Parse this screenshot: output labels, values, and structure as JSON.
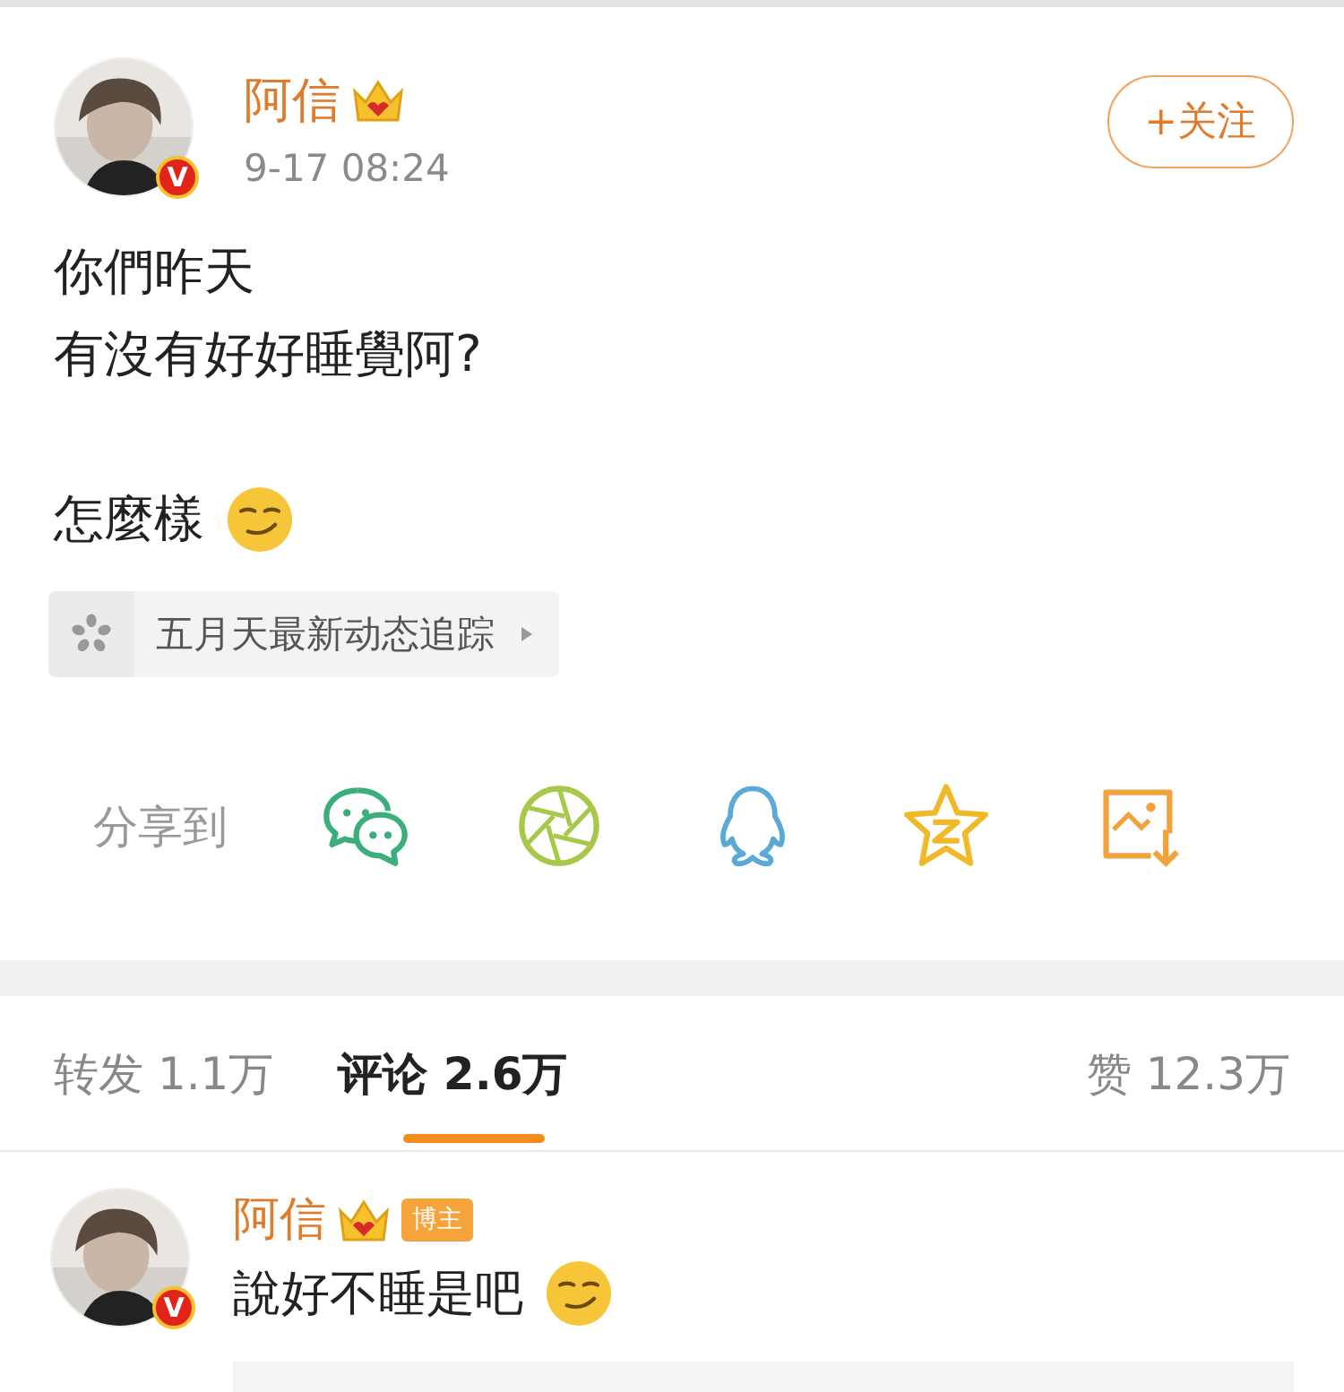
{
  "post": {
    "author": {
      "name": "阿信",
      "crown": true,
      "verified_badge": "V"
    },
    "time": "9-17 08:24",
    "follow_button": "+关注",
    "paragraphs": [
      {
        "lines": [
          "你們昨天",
          "有沒有好好睡覺阿?"
        ],
        "emoji": false
      },
      {
        "lines": [
          "怎麼樣"
        ],
        "emoji": true
      }
    ],
    "topic": {
      "label": "五月天最新动态追踪"
    },
    "share": {
      "label": "分享到",
      "targets": [
        {
          "kind": "wechat"
        },
        {
          "kind": "moments"
        },
        {
          "kind": "qq"
        },
        {
          "kind": "qzone"
        },
        {
          "kind": "save"
        }
      ]
    }
  },
  "tabs": [
    {
      "label": "转发",
      "count": "1.1万",
      "selected": false
    },
    {
      "label": "评论",
      "count": "2.6万",
      "selected": true
    },
    {
      "label": "赞",
      "count": "12.3万",
      "selected": false
    }
  ],
  "comments": [
    {
      "name": "阿信",
      "crown": true,
      "verified_badge": "V",
      "tag": "博主",
      "text": "說好不睡是吧",
      "emoji": true
    }
  ]
}
